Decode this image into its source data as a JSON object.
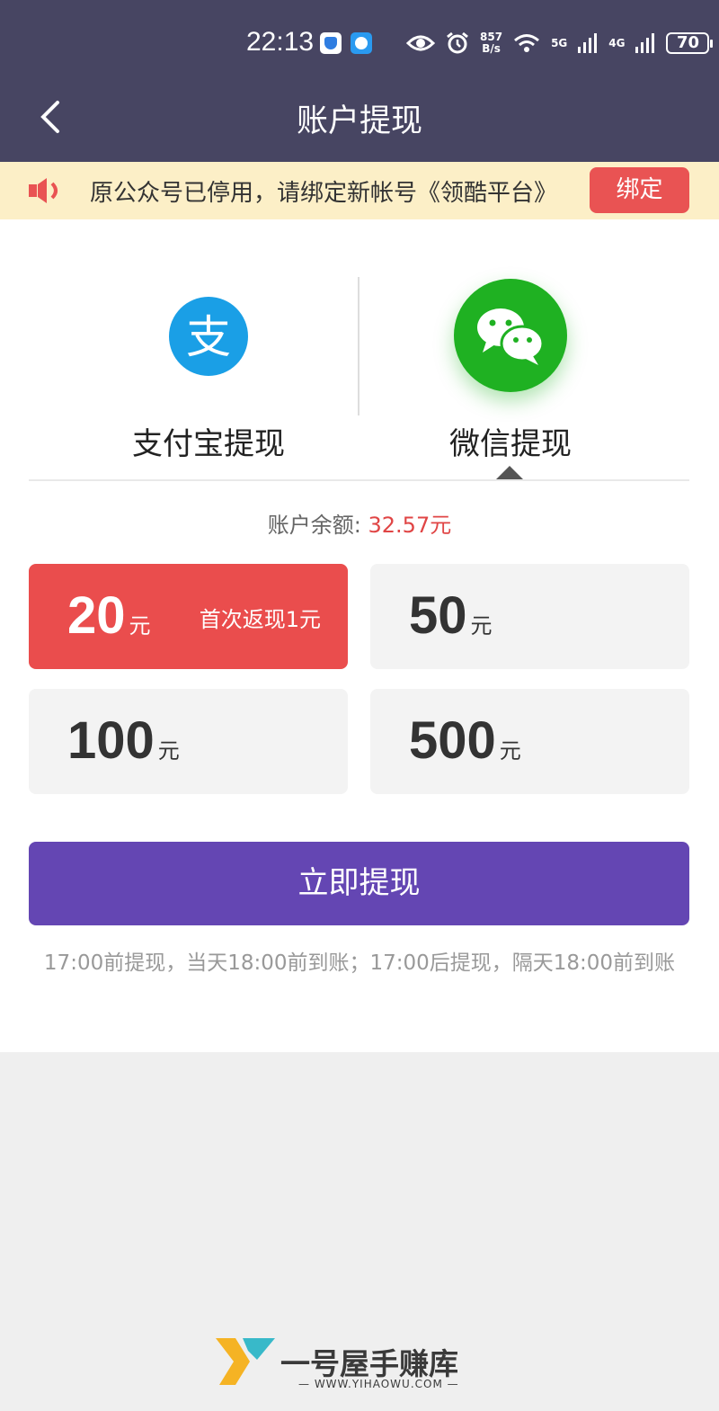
{
  "status_bar": {
    "time": "22:13",
    "net_speed_top": "857",
    "net_speed_bottom": "B/s",
    "signal_1": "5G",
    "signal_2": "4G",
    "battery": "70"
  },
  "header": {
    "title": "账户提现"
  },
  "notice": {
    "text": "原公众号已停用，请绑定新帐号《领酷平台》",
    "button_label": "绑定"
  },
  "methods": [
    {
      "label": "支付宝提现",
      "icon": "alipay-icon",
      "color": "#1a9fe6"
    },
    {
      "label": "微信提现",
      "icon": "wechat-icon",
      "color": "#1fb122"
    }
  ],
  "selected_method": "微信提现",
  "balance": {
    "label": "账户余额:",
    "amount": "32.57元"
  },
  "amount_options": [
    {
      "value": "20",
      "unit": "元",
      "promo": "首次返现1元",
      "selected": true
    },
    {
      "value": "50",
      "unit": "元",
      "promo": "",
      "selected": false
    },
    {
      "value": "100",
      "unit": "元",
      "promo": "",
      "selected": false
    },
    {
      "value": "500",
      "unit": "元",
      "promo": "",
      "selected": false
    }
  ],
  "withdraw_button": "立即提现",
  "note": "17:00前提现，当天18:00前到账；17:00后提现，隔天18:00前到账",
  "watermark": {
    "name": "一号屋手赚库",
    "url": "— WWW.YIHAOWU.COM —"
  },
  "colors": {
    "header": "#474562",
    "accent_red": "#e95353",
    "primary": "#6446b3",
    "notice_bg": "#fcefc7"
  }
}
